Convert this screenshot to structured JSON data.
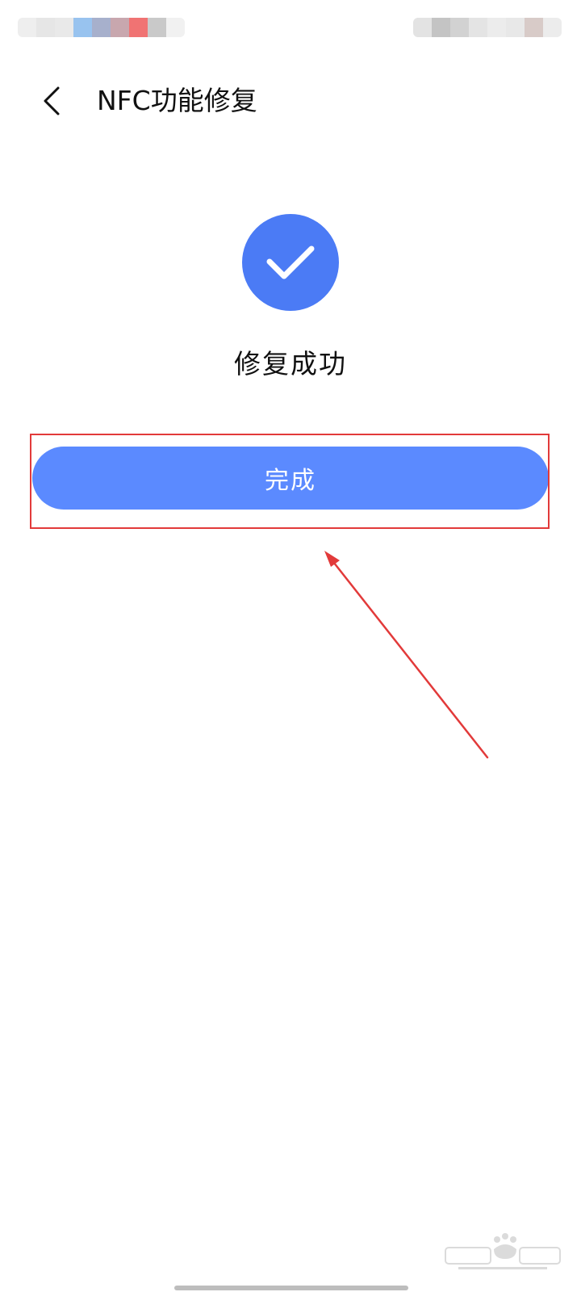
{
  "header": {
    "title": "NFC功能修复"
  },
  "result": {
    "message": "修复成功",
    "icon": "check-icon",
    "icon_color": "#4b7bf5"
  },
  "actions": {
    "done_label": "完成",
    "done_color": "#5b8aff"
  },
  "annotation": {
    "color": "#e23a3a"
  }
}
